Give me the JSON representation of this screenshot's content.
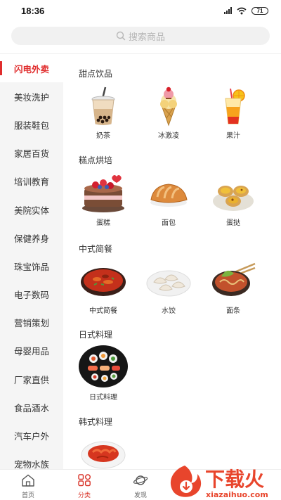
{
  "status_bar": {
    "time": "18:36",
    "battery": "71"
  },
  "search": {
    "placeholder": "搜索商品"
  },
  "sidebar": {
    "items": [
      {
        "label": "闪电外卖",
        "active": true
      },
      {
        "label": "美妆洗护"
      },
      {
        "label": "服装鞋包"
      },
      {
        "label": "家居百货"
      },
      {
        "label": "培训教育"
      },
      {
        "label": "美院实体"
      },
      {
        "label": "保健养身"
      },
      {
        "label": "珠宝饰品"
      },
      {
        "label": "电子数码"
      },
      {
        "label": "营销策划"
      },
      {
        "label": "母婴用品"
      },
      {
        "label": "厂家直供"
      },
      {
        "label": "食品酒水"
      },
      {
        "label": "汽车户外"
      },
      {
        "label": "宠物水族"
      }
    ]
  },
  "sections": [
    {
      "title": "甜点饮品",
      "items": [
        "奶茶",
        "冰激凌",
        "果汁"
      ]
    },
    {
      "title": "糕点烘培",
      "items": [
        "蛋糕",
        "面包",
        "蛋挞"
      ]
    },
    {
      "title": "中式简餐",
      "items": [
        "中式简餐",
        "水饺",
        "面条"
      ]
    },
    {
      "title": "日式料理",
      "items": [
        "日式料理"
      ]
    },
    {
      "title": "韩式料理",
      "items": []
    }
  ],
  "tabs": [
    {
      "label": "首页"
    },
    {
      "label": "分类",
      "active": true
    },
    {
      "label": "发现"
    }
  ],
  "watermark": {
    "brand": "下载火",
    "url": "xiazaihuo.com"
  },
  "colors": {
    "accent": "#e02d2d",
    "sidebar_bg": "#f5f5f5",
    "search_bg": "#f1f1f1",
    "watermark": "#e8452c"
  }
}
